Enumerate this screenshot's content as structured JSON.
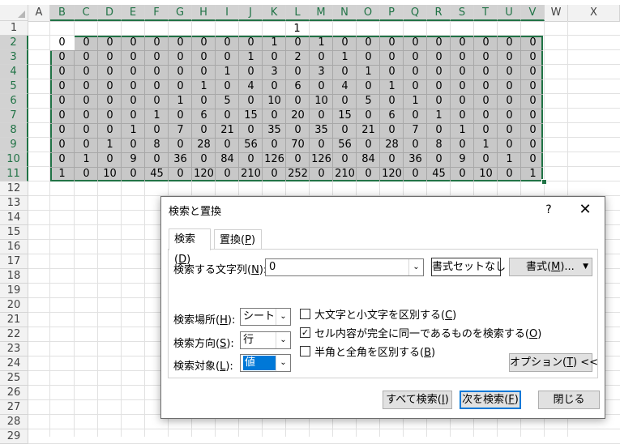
{
  "sheet": {
    "columns": [
      "A",
      "B",
      "C",
      "D",
      "E",
      "F",
      "G",
      "H",
      "I",
      "J",
      "K",
      "L",
      "M",
      "N",
      "O",
      "P",
      "Q",
      "R",
      "S",
      "T",
      "U",
      "V",
      "W",
      "X"
    ],
    "rows": [
      "1",
      "2",
      "3",
      "4",
      "5",
      "6",
      "7",
      "8",
      "9",
      "10",
      "11",
      "12",
      "13",
      "14",
      "15",
      "16",
      "17",
      "18",
      "19",
      "20",
      "21",
      "22",
      "23",
      "24",
      "25",
      "26",
      "27",
      "28",
      "29"
    ],
    "l1_value": "1",
    "cells": [
      [
        "0",
        "0",
        "0",
        "0",
        "0",
        "0",
        "0",
        "0",
        "0",
        "1",
        "0",
        "1",
        "0",
        "0",
        "0",
        "0",
        "0",
        "0",
        "0",
        "0"
      ],
      [
        "0",
        "0",
        "0",
        "0",
        "0",
        "0",
        "0",
        "0",
        "1",
        "0",
        "2",
        "0",
        "1",
        "0",
        "0",
        "0",
        "0",
        "0",
        "0",
        "0"
      ],
      [
        "0",
        "0",
        "0",
        "0",
        "0",
        "0",
        "0",
        "1",
        "0",
        "3",
        "0",
        "3",
        "0",
        "1",
        "0",
        "0",
        "0",
        "0",
        "0",
        "0"
      ],
      [
        "0",
        "0",
        "0",
        "0",
        "0",
        "0",
        "1",
        "0",
        "4",
        "0",
        "6",
        "0",
        "4",
        "0",
        "1",
        "0",
        "0",
        "0",
        "0",
        "0"
      ],
      [
        "0",
        "0",
        "0",
        "0",
        "0",
        "1",
        "0",
        "5",
        "0",
        "10",
        "0",
        "10",
        "0",
        "5",
        "0",
        "1",
        "0",
        "0",
        "0",
        "0"
      ],
      [
        "0",
        "0",
        "0",
        "0",
        "1",
        "0",
        "6",
        "0",
        "15",
        "0",
        "20",
        "0",
        "15",
        "0",
        "6",
        "0",
        "1",
        "0",
        "0",
        "0"
      ],
      [
        "0",
        "0",
        "0",
        "1",
        "0",
        "7",
        "0",
        "21",
        "0",
        "35",
        "0",
        "35",
        "0",
        "21",
        "0",
        "7",
        "0",
        "1",
        "0",
        "0"
      ],
      [
        "0",
        "0",
        "1",
        "0",
        "8",
        "0",
        "28",
        "0",
        "56",
        "0",
        "70",
        "0",
        "56",
        "0",
        "28",
        "0",
        "8",
        "0",
        "1",
        "0"
      ],
      [
        "0",
        "1",
        "0",
        "9",
        "0",
        "36",
        "0",
        "84",
        "0",
        "126",
        "0",
        "126",
        "0",
        "84",
        "0",
        "36",
        "0",
        "9",
        "0",
        "1"
      ],
      [
        "1",
        "0",
        "10",
        "0",
        "45",
        "0",
        "120",
        "0",
        "210",
        "0",
        "252",
        "0",
        "210",
        "0",
        "120",
        "0",
        "45",
        "0",
        "10",
        "0"
      ]
    ],
    "v_column": [
      "0",
      "0",
      "0",
      "0",
      "0",
      "0",
      "0",
      "0",
      "0",
      "1"
    ],
    "accent": "#217346"
  },
  "dialog": {
    "title": "検索と置換",
    "help": "?",
    "close": "✕",
    "tabs": {
      "find": "検索",
      "find_key": "D",
      "replace": "置換",
      "replace_key": "P"
    },
    "find_what_label": "検索する文字列",
    "find_what_key": "N",
    "find_what_value": "0",
    "no_format_label": "書式セットなし",
    "format_label": "書式",
    "format_key": "M",
    "within_label": "検索場所",
    "within_key": "H",
    "within_value": "シート",
    "search_label": "検索方向",
    "search_key": "S",
    "search_value": "行",
    "lookin_label": "検索対象",
    "lookin_key": "L",
    "lookin_value": "値",
    "match_case_label": "大文字と小文字を区別する",
    "match_case_key": "C",
    "match_case_checked": false,
    "match_entire_label": "セル内容が完全に同一であるものを検索する",
    "match_entire_key": "O",
    "match_entire_checked": true,
    "match_width_label": "半角と全角を区別する",
    "match_width_key": "B",
    "match_width_checked": false,
    "options_label": "オプション",
    "options_key": "T",
    "options_suffix": "<<",
    "find_all_label": "すべて検索",
    "find_all_key": "I",
    "find_next_label": "次を検索",
    "find_next_key": "F",
    "close_label": "閉じる",
    "highlight": "#0078d7"
  }
}
